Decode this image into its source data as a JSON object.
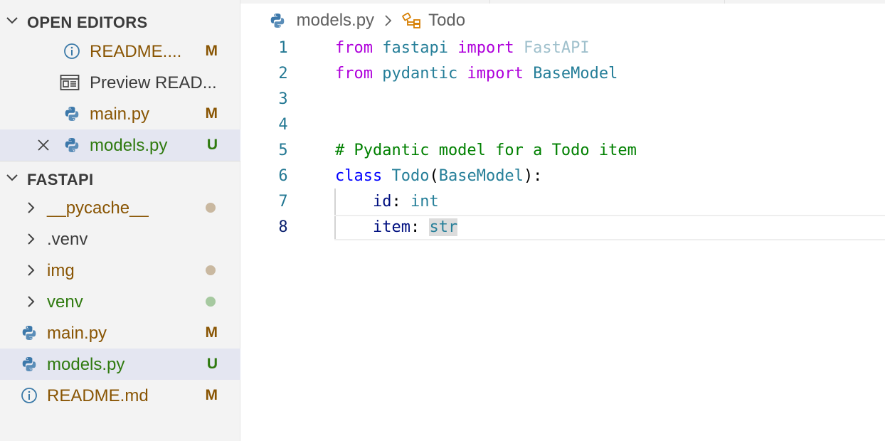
{
  "sidebar": {
    "open_editors": {
      "title": "OPEN EDITORS",
      "items": [
        {
          "label": "README....",
          "badge": "M",
          "icon": "info-icon"
        },
        {
          "label": "Preview READ...",
          "badge": "",
          "icon": "preview-icon"
        },
        {
          "label": "main.py",
          "badge": "M",
          "icon": "python-icon"
        },
        {
          "label": "models.py",
          "badge": "U",
          "icon": "python-icon"
        }
      ]
    },
    "explorer": {
      "title": "FASTAPI",
      "items": [
        {
          "label": "__pycache__",
          "type": "folder"
        },
        {
          "label": ".venv",
          "type": "folder"
        },
        {
          "label": "img",
          "type": "folder"
        },
        {
          "label": "venv",
          "type": "folder"
        },
        {
          "label": "main.py",
          "badge": "M",
          "type": "file"
        },
        {
          "label": "models.py",
          "badge": "U",
          "type": "file"
        },
        {
          "label": "README.md",
          "badge": "M",
          "type": "file"
        }
      ]
    }
  },
  "editor": {
    "breadcrumb": {
      "file": "models.py",
      "symbol": "Todo"
    },
    "lines": [
      {
        "n": "1",
        "tokens": [
          [
            "from",
            "kw-imp"
          ],
          [
            " ",
            ""
          ],
          [
            "fastapi",
            "mod"
          ],
          [
            " ",
            ""
          ],
          [
            "import",
            "kw-imp"
          ],
          [
            " ",
            ""
          ],
          [
            "FastAPI",
            "unused"
          ]
        ]
      },
      {
        "n": "2",
        "tokens": [
          [
            "from",
            "kw-imp"
          ],
          [
            " ",
            ""
          ],
          [
            "pydantic",
            "mod"
          ],
          [
            " ",
            ""
          ],
          [
            "import",
            "kw-imp"
          ],
          [
            " ",
            ""
          ],
          [
            "BaseModel",
            "cls"
          ]
        ]
      },
      {
        "n": "3",
        "tokens": []
      },
      {
        "n": "4",
        "tokens": []
      },
      {
        "n": "5",
        "tokens": [
          [
            "# Pydantic model for a Todo item",
            "cmt"
          ]
        ]
      },
      {
        "n": "6",
        "tokens": [
          [
            "class",
            "kw"
          ],
          [
            " ",
            ""
          ],
          [
            "Todo",
            "cls"
          ],
          [
            "(",
            ""
          ],
          [
            "BaseModel",
            "cls"
          ],
          [
            "):",
            ""
          ]
        ]
      },
      {
        "n": "7",
        "tokens": [
          [
            "    ",
            ""
          ],
          [
            "id",
            "var"
          ],
          [
            ": ",
            ""
          ],
          [
            "int",
            "typ"
          ]
        ]
      },
      {
        "n": "8",
        "tokens": [
          [
            "    ",
            ""
          ],
          [
            "item",
            "var"
          ],
          [
            ": ",
            ""
          ],
          [
            "str",
            "typ hl"
          ]
        ]
      }
    ],
    "active_line": "8"
  },
  "colors": {
    "modified": "#895503",
    "untracked": "#2f7a0f",
    "selection": "#e4e6f1"
  }
}
